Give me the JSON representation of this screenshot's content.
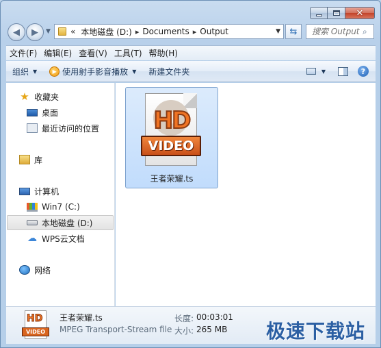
{
  "window": {
    "caption": {
      "minimize": "minimize",
      "maximize": "maximize",
      "close": "✕"
    }
  },
  "address_bar": {
    "overflow": "«",
    "path": [
      "本地磁盘 (D:)",
      "Documents",
      "Output"
    ],
    "separator": "▸"
  },
  "search": {
    "placeholder": "搜索 Output"
  },
  "menu": {
    "items": [
      "文件(F)",
      "编辑(E)",
      "查看(V)",
      "工具(T)",
      "帮助(H)"
    ]
  },
  "commands": {
    "organize": "组织",
    "play_with": "使用射手影音播放",
    "new_folder": "新建文件夹"
  },
  "nav_pane": {
    "favorites": {
      "label": "收藏夹",
      "items": [
        "桌面",
        "最近访问的位置"
      ]
    },
    "libraries": {
      "label": "库"
    },
    "computer": {
      "label": "计算机",
      "items": [
        "Win7 (C:)",
        "本地磁盘 (D:)",
        "WPS云文档"
      ]
    },
    "network": {
      "label": "网络"
    },
    "selected": "本地磁盘 (D:)"
  },
  "files": [
    {
      "name": "王者荣耀.ts",
      "icon_badge_top": "HD",
      "icon_badge_bottom": "VIDEO",
      "selected": true
    }
  ],
  "details": {
    "name": "王者荣耀.ts",
    "type": "MPEG Transport-Stream file",
    "duration_label": "长度:",
    "duration": "00:03:01",
    "size_label": "大小:",
    "size": "265 MB",
    "icon_badge_top": "HD",
    "icon_badge_bottom": "VIDEO"
  },
  "watermark": "极速下载站",
  "colors": {
    "accent": "#2b5fa3",
    "selection": "#c1dcfc",
    "icon_orange": "#f07424"
  }
}
